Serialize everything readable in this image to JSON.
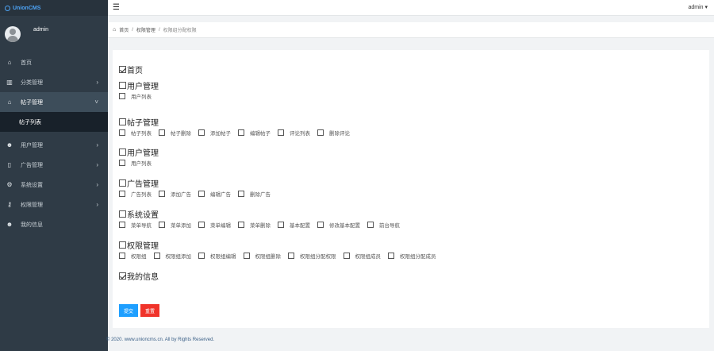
{
  "brand": {
    "name": "UnionCMS"
  },
  "user": {
    "name": "admin"
  },
  "sidebar": {
    "items": [
      {
        "label": "首页",
        "icon": "home-icon",
        "glyph": "⌂",
        "chevron": ""
      },
      {
        "label": "分类管理",
        "icon": "bar-chart-icon",
        "glyph": "▥",
        "chevron": "›"
      },
      {
        "label": "帖子管理",
        "icon": "bank-icon",
        "glyph": "⌂",
        "chevron": "˅"
      },
      {
        "label": "帖子列表",
        "icon": "",
        "glyph": "",
        "chevron": ""
      },
      {
        "label": "用户管理",
        "icon": "users-icon",
        "glyph": "☻",
        "chevron": "›"
      },
      {
        "label": "广告管理",
        "icon": "file-icon",
        "glyph": "▯",
        "chevron": "›"
      },
      {
        "label": "系统设置",
        "icon": "gear-icon",
        "glyph": "⚙",
        "chevron": "›"
      },
      {
        "label": "权限管理",
        "icon": "key-icon",
        "glyph": "⚷",
        "chevron": "›"
      },
      {
        "label": "我的信息",
        "icon": "user-info-icon",
        "glyph": "☻",
        "chevron": ""
      }
    ]
  },
  "topbar": {
    "menu_glyph": "☰",
    "user": "admin ▾"
  },
  "breadcrumb": {
    "home_glyph": "⌂",
    "items": [
      "首页",
      "权限管理",
      "权限组分配权限"
    ]
  },
  "permissions": [
    {
      "label": "首页",
      "checked": true,
      "children": []
    },
    {
      "label": "用户管理",
      "checked": false,
      "children": [
        "用户列表"
      ]
    },
    {
      "label": "帖子管理",
      "checked": false,
      "children": [
        "帖子列表",
        "帖子删除",
        "添加帖子",
        "编辑帖子",
        "评论列表",
        "删除评论"
      ]
    },
    {
      "label": "用户管理",
      "checked": false,
      "children": [
        "用户列表"
      ]
    },
    {
      "label": "广告管理",
      "checked": false,
      "children": [
        "广告列表",
        "添加广告",
        "编辑广告",
        "删除广告"
      ]
    },
    {
      "label": "系统设置",
      "checked": false,
      "children": [
        "菜单导航",
        "菜单添加",
        "菜单编辑",
        "菜单删除",
        "基本配置",
        "修改基本配置",
        "前台导航"
      ]
    },
    {
      "label": "权限管理",
      "checked": false,
      "children": [
        "权限组",
        "权限组添加",
        "权限组编辑",
        "权限组删除",
        "权限组分配权限",
        "权限组成员",
        "权限组分配成员"
      ]
    },
    {
      "label": "我的信息",
      "checked": true,
      "children": []
    }
  ],
  "buttons": {
    "submit": "提交",
    "reset": "重置"
  },
  "footer": "© 2020. www.unioncms.cn. All by Rights Reserved.",
  "colors": {
    "sidebar_bg": "#2f3b46",
    "active_bg": "#3d4d5a",
    "submit": "#1e9fff",
    "reset": "#f0332a",
    "brand": "#4da3f5"
  }
}
